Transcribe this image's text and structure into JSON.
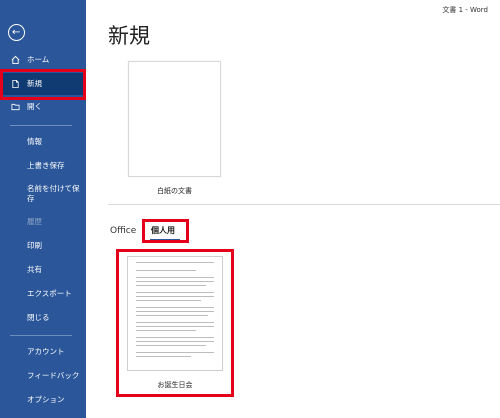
{
  "window": {
    "title": "文書 1  -  Word"
  },
  "sidebar": {
    "items": [
      {
        "label": "ホーム",
        "icon": "home-icon"
      },
      {
        "label": "新規",
        "icon": "new-document-icon",
        "selected": true
      },
      {
        "label": "開く",
        "icon": "open-folder-icon"
      },
      {
        "label": "情報"
      },
      {
        "label": "上書き保存"
      },
      {
        "label": "名前を付けて保存"
      },
      {
        "label": "履歴",
        "disabled": true
      },
      {
        "label": "印刷"
      },
      {
        "label": "共有"
      },
      {
        "label": "エクスポート"
      },
      {
        "label": "閉じる"
      },
      {
        "label": "アカウント"
      },
      {
        "label": "フィードバック"
      },
      {
        "label": "オプション"
      }
    ]
  },
  "main": {
    "title": "新規",
    "blank_document": {
      "label": "白紙の文書"
    },
    "tabs": [
      {
        "label": "Office",
        "selected": false
      },
      {
        "label": "個人用",
        "selected": true
      }
    ],
    "templates": [
      {
        "label": "お誕生日会"
      }
    ]
  },
  "colors": {
    "sidebar": "#2b579a",
    "selected": "#0f3a72",
    "highlight": "#e4001b",
    "accent": "#2b579a"
  }
}
